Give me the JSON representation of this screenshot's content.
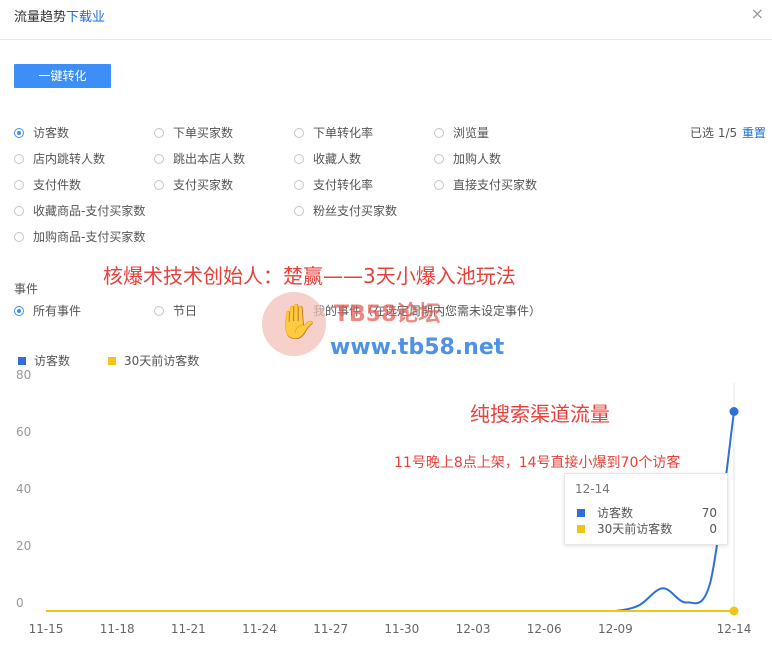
{
  "header": {
    "title": "流量趋势",
    "title_link": "下载业",
    "close": "×"
  },
  "toolbar": {
    "convert_label": "一键转化"
  },
  "metrics": {
    "items": [
      {
        "label": "访客数",
        "checked": true
      },
      {
        "label": "下单买家数",
        "checked": false
      },
      {
        "label": "下单转化率",
        "checked": false
      },
      {
        "label": "浏览量",
        "checked": false
      },
      {
        "label": "店内跳转人数",
        "checked": false
      },
      {
        "label": "跳出本店人数",
        "checked": false
      },
      {
        "label": "收藏人数",
        "checked": false
      },
      {
        "label": "加购人数",
        "checked": false
      },
      {
        "label": "支付件数",
        "checked": false
      },
      {
        "label": "支付买家数",
        "checked": false
      },
      {
        "label": "支付转化率",
        "checked": false
      },
      {
        "label": "直接支付买家数",
        "checked": false
      },
      {
        "label": "收藏商品-支付买家数",
        "checked": false
      },
      {
        "label": "粉丝支付买家数",
        "checked": false
      },
      {
        "label": "加购商品-支付买家数",
        "checked": false
      }
    ],
    "selected_count": "已选 1/5",
    "reset_label": "重置"
  },
  "overlay": {
    "headline": "核爆术技术创始人：楚赢——3天小爆入池玩法",
    "channel_note": "纯搜索渠道流量",
    "detail_note": "11号晚上8点上架，14号直接小爆到70个访客"
  },
  "events": {
    "label": "事件",
    "options": [
      {
        "label": "所有事件",
        "checked": true
      },
      {
        "label": "节日",
        "checked": false
      },
      {
        "label": "我的事件（在选定周期内您需未设定事件）",
        "checked": false
      }
    ]
  },
  "watermark": {
    "title": "TB58论坛",
    "url": "www.tb58.net"
  },
  "legend": [
    {
      "label": "访客数",
      "color": "#2f6fd8"
    },
    {
      "label": "30天前访客数",
      "color": "#f0c419"
    }
  ],
  "tooltip": {
    "date": "12-14",
    "rows": [
      {
        "label": "访客数",
        "value": "70",
        "color": "#2f6fd8"
      },
      {
        "label": "30天前访客数",
        "value": "0",
        "color": "#f0c419"
      }
    ]
  },
  "chart_data": {
    "type": "line",
    "x": [
      "11-15",
      "11-16",
      "11-17",
      "11-18",
      "11-19",
      "11-20",
      "11-21",
      "11-22",
      "11-23",
      "11-24",
      "11-25",
      "11-26",
      "11-27",
      "11-28",
      "11-29",
      "11-30",
      "12-01",
      "12-02",
      "12-03",
      "12-04",
      "12-05",
      "12-06",
      "12-07",
      "12-08",
      "12-09",
      "12-10",
      "12-11",
      "12-12",
      "12-13",
      "12-14"
    ],
    "xticks": [
      "11-15",
      "11-18",
      "11-21",
      "11-24",
      "11-27",
      "11-30",
      "12-03",
      "12-06",
      "12-09",
      "12-14"
    ],
    "yticks": [
      0,
      20,
      40,
      60,
      80
    ],
    "ylim": [
      0,
      80
    ],
    "series": [
      {
        "name": "访客数",
        "color": "#2f6fd8",
        "values": [
          0,
          0,
          0,
          0,
          0,
          0,
          0,
          0,
          0,
          0,
          0,
          0,
          0,
          0,
          0,
          0,
          0,
          0,
          0,
          0,
          0,
          0,
          0,
          0,
          0,
          2,
          8,
          3,
          10,
          70
        ]
      },
      {
        "name": "30天前访客数",
        "color": "#f0c419",
        "values": [
          0,
          0,
          0,
          0,
          0,
          0,
          0,
          0,
          0,
          0,
          0,
          0,
          0,
          0,
          0,
          0,
          0,
          0,
          0,
          0,
          0,
          0,
          0,
          0,
          0,
          0,
          0,
          0,
          0,
          0
        ]
      }
    ]
  }
}
